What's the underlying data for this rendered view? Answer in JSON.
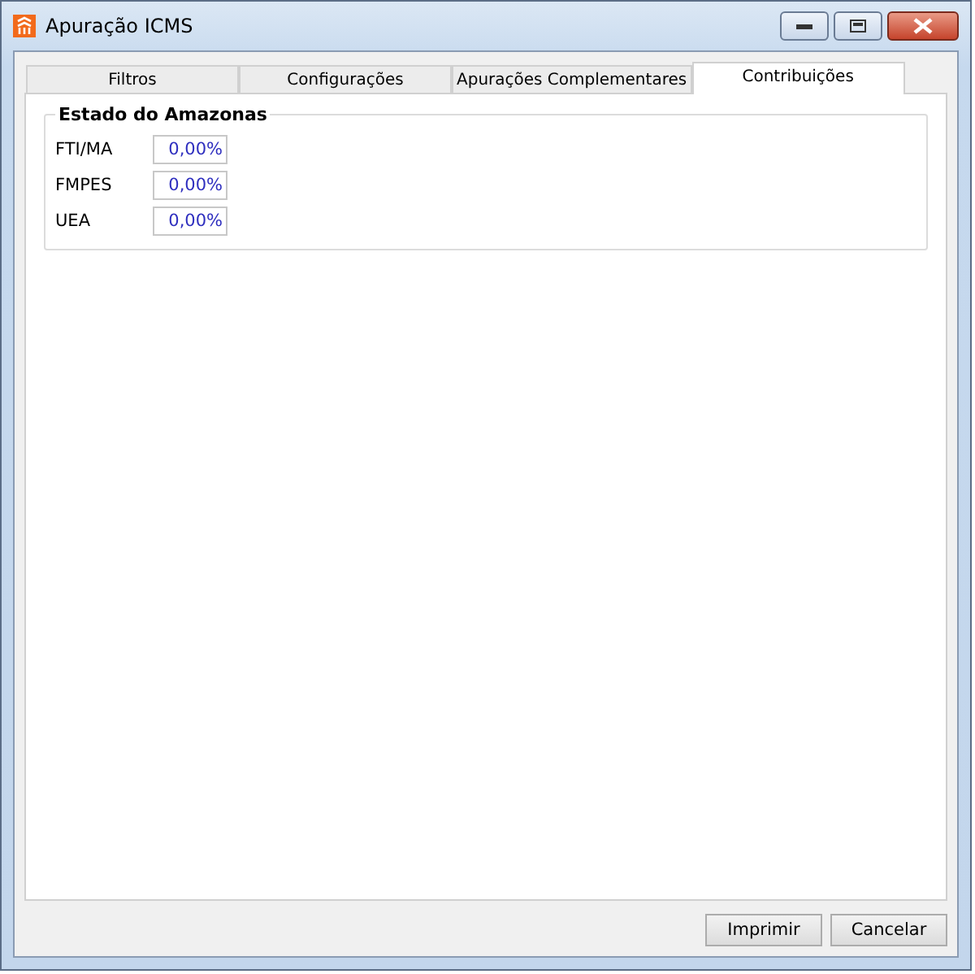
{
  "window": {
    "title": "Apuração ICMS"
  },
  "tabs": [
    {
      "label": "Filtros",
      "selected": false
    },
    {
      "label": "Configurações",
      "selected": false
    },
    {
      "label": "Apurações Complementares",
      "selected": false
    },
    {
      "label": "Contribuições",
      "selected": true
    }
  ],
  "group": {
    "title": "Estado do Amazonas",
    "fields": [
      {
        "label": "FTI/MA",
        "value": "0,00%"
      },
      {
        "label": "FMPES",
        "value": "0,00%"
      },
      {
        "label": "UEA",
        "value": "0,00%"
      }
    ]
  },
  "buttons": [
    "Imprimir",
    "Cancelar"
  ]
}
